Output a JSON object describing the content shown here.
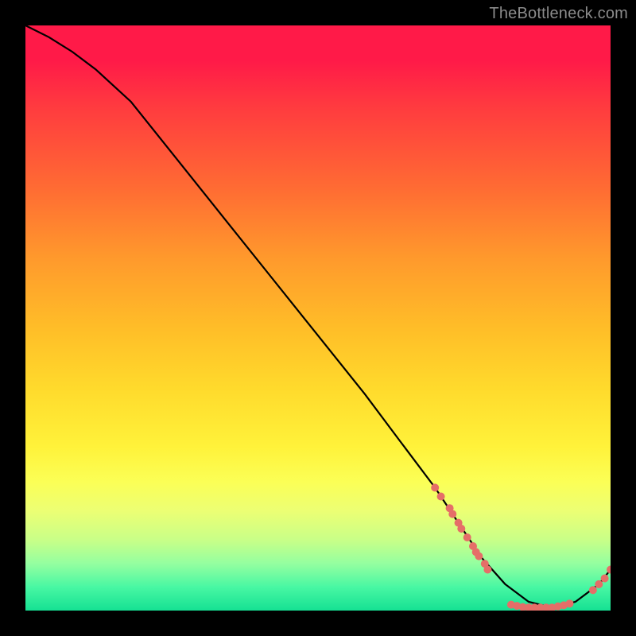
{
  "watermark": "TheBottleneck.com",
  "chart_data": {
    "type": "line",
    "title": "",
    "xlabel": "",
    "ylabel": "",
    "xlim": [
      0,
      100
    ],
    "ylim": [
      0,
      100
    ],
    "grid": false,
    "legend": false,
    "series": [
      {
        "name": "curve",
        "color": "#000000",
        "x": [
          0,
          4,
          8,
          12,
          18,
          26,
          34,
          42,
          50,
          58,
          64,
          70,
          74,
          78,
          82,
          86,
          90,
          94,
          98,
          100
        ],
        "y": [
          100,
          98,
          95.5,
          92.5,
          87,
          77,
          67,
          57,
          47,
          37,
          29,
          21,
          15,
          9,
          4.5,
          1.5,
          0.5,
          1.5,
          4.5,
          7
        ]
      },
      {
        "name": "markers-descent",
        "color": "#e56e68",
        "type": "scatter",
        "x": [
          70,
          71,
          72.5,
          73,
          74,
          74.5,
          75.5,
          76.5,
          77,
          77.5,
          78.5,
          79
        ],
        "y": [
          21,
          19.5,
          17.5,
          16.5,
          15,
          14,
          12.5,
          11,
          10,
          9.3,
          8,
          7
        ]
      },
      {
        "name": "markers-valley",
        "color": "#e56e68",
        "type": "scatter",
        "x": [
          83,
          84,
          85,
          86,
          87,
          88,
          89,
          90,
          91,
          92,
          93
        ],
        "y": [
          1.0,
          0.8,
          0.6,
          0.5,
          0.5,
          0.5,
          0.5,
          0.5,
          0.7,
          0.9,
          1.2
        ]
      },
      {
        "name": "markers-rise",
        "color": "#e56e68",
        "type": "scatter",
        "x": [
          97,
          98,
          99,
          100
        ],
        "y": [
          3.5,
          4.5,
          5.5,
          7
        ]
      }
    ],
    "background_gradient": {
      "orientation": "vertical",
      "stops": [
        {
          "pos": 0.0,
          "color": "#ff1a48"
        },
        {
          "pos": 0.28,
          "color": "#ff6c33"
        },
        {
          "pos": 0.52,
          "color": "#ffbe28"
        },
        {
          "pos": 0.72,
          "color": "#fff23a"
        },
        {
          "pos": 0.88,
          "color": "#c8ff88"
        },
        {
          "pos": 1.0,
          "color": "#15e193"
        }
      ]
    }
  }
}
